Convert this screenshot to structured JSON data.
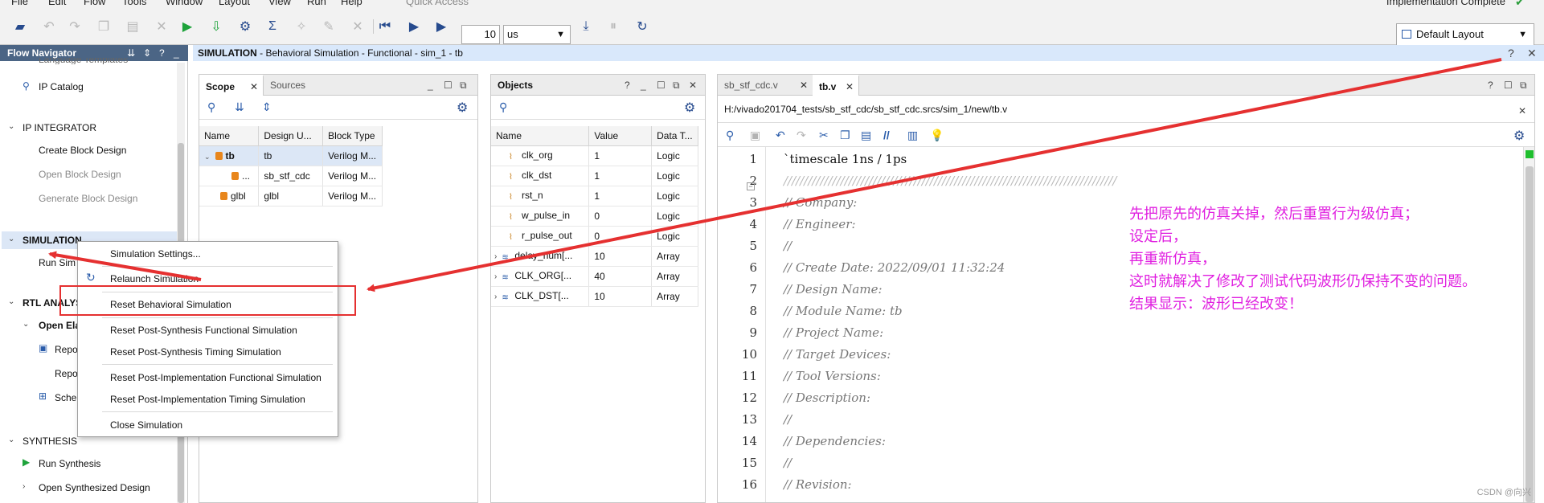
{
  "menubar": {
    "items": [
      "File",
      "Edit",
      "Flow",
      "Tools",
      "Window",
      "Layout",
      "View",
      "Run",
      "Help"
    ],
    "quick_access": "Quick Access",
    "status": "Implementation Complete"
  },
  "toolbar": {
    "time_value": "10",
    "time_unit": "us",
    "layout": "Default Layout"
  },
  "flow_navigator": {
    "title": "Flow Navigator",
    "items": {
      "language_templates": "Language Templates",
      "ip_catalog": "IP Catalog",
      "ip_integrator": "IP INTEGRATOR",
      "create_block_design": "Create Block Design",
      "open_block_design": "Open Block Design",
      "generate_block_design": "Generate Block Design",
      "simulation": "SIMULATION",
      "run_simulation": "Run Sim",
      "rtl_analysis": "RTL ANALYS",
      "open_elaborated": "Open Ela",
      "report": "Repo",
      "report2": "Repo",
      "schematic": "Sche",
      "synthesis": "SYNTHESIS",
      "run_synthesis": "Run Synthesis",
      "open_synthesized": "Open Synthesized Design"
    }
  },
  "main_header": {
    "prefix": "SIMULATION",
    "rest": " - Behavioral Simulation - Functional - sim_1 - tb"
  },
  "scope_panel": {
    "tabs": [
      "Scope",
      "Sources"
    ],
    "columns": [
      "Name",
      "Design U...",
      "Block Type"
    ],
    "rows": [
      {
        "name": "tb",
        "design": "tb",
        "block": "Verilog M..."
      },
      {
        "name": "...",
        "design": "sb_stf_cdc",
        "block": "Verilog M..."
      },
      {
        "name": "glbl",
        "design": "glbl",
        "block": "Verilog M..."
      }
    ]
  },
  "objects_panel": {
    "title": "Objects",
    "columns": [
      "Name",
      "Value",
      "Data T..."
    ],
    "rows": [
      {
        "name": "clk_org",
        "value": "1",
        "type": "Logic"
      },
      {
        "name": "clk_dst",
        "value": "1",
        "type": "Logic"
      },
      {
        "name": "rst_n",
        "value": "1",
        "type": "Logic"
      },
      {
        "name": "w_pulse_in",
        "value": "0",
        "type": "Logic"
      },
      {
        "name": "r_pulse_out",
        "value": "0",
        "type": "Logic"
      },
      {
        "name": "delay_num[...",
        "value": "10",
        "type": "Array"
      },
      {
        "name": "CLK_ORG[...",
        "value": "40",
        "type": "Array"
      },
      {
        "name": "CLK_DST[...",
        "value": "10",
        "type": "Array"
      }
    ]
  },
  "editor": {
    "tabs": [
      "sb_stf_cdc.v",
      "tb.v"
    ],
    "path": "H:/vivado201704_tests/sb_stf_cdc/sb_stf_cdc.srcs/sim_1/new/tb.v",
    "lines": [
      {
        "num": "1",
        "text": "`timescale 1ns / 1ps"
      },
      {
        "num": "2",
        "text": "//////////////////////////////////////////////////////////////////////////////////"
      },
      {
        "num": "3",
        "text": "// Company:"
      },
      {
        "num": "4",
        "text": "// Engineer:"
      },
      {
        "num": "5",
        "text": "//"
      },
      {
        "num": "6",
        "text": "// Create Date: 2022/09/01 11:32:24"
      },
      {
        "num": "7",
        "text": "// Design Name:"
      },
      {
        "num": "8",
        "text": "// Module Name: tb"
      },
      {
        "num": "9",
        "text": "// Project Name:"
      },
      {
        "num": "10",
        "text": "// Target Devices:"
      },
      {
        "num": "11",
        "text": "// Tool Versions:"
      },
      {
        "num": "12",
        "text": "// Description:"
      },
      {
        "num": "13",
        "text": "//"
      },
      {
        "num": "14",
        "text": "// Dependencies:"
      },
      {
        "num": "15",
        "text": "//"
      },
      {
        "num": "16",
        "text": "// Revision:"
      }
    ]
  },
  "annotation": [
    "先把原先的仿真关掉，然后重置行为级仿真；",
    "设定后，",
    "再重新仿真，",
    "这时就解决了修改了测试代码波形仍保持不变的问题。",
    "结果显示：波形已经改变！"
  ],
  "context_menu": {
    "items": [
      "Simulation Settings...",
      "Relaunch Simulation",
      "Reset Behavioral Simulation",
      "Reset Post-Synthesis Functional Simulation",
      "Reset Post-Synthesis Timing Simulation",
      "Reset Post-Implementation Functional Simulation",
      "Reset Post-Implementation Timing Simulation",
      "Close Simulation"
    ]
  },
  "watermark": "CSDN @向兴",
  "colors": {
    "header_bg": "#4b6585",
    "main_header_bg": "#d9e8fb",
    "annotation": "#e020e0",
    "arrow": "#e53030"
  }
}
